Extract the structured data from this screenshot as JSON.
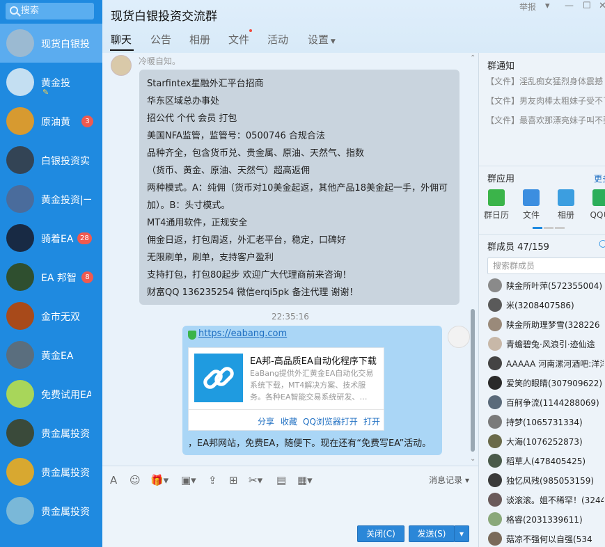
{
  "sidebar": {
    "search_placeholder": "搜索",
    "conversations": [
      {
        "name": "现货白银投",
        "badge": "",
        "color": "#9bbad2"
      },
      {
        "name": "黄金投",
        "badge": "",
        "color": "#c4dff2"
      },
      {
        "name": "原油黄",
        "badge": "3",
        "color": "#d79a30"
      },
      {
        "name": "白银投资实",
        "badge": "",
        "color": "#334455"
      },
      {
        "name": "黄金投资|一",
        "badge": "",
        "color": "#4a6c9c"
      },
      {
        "name": "骑着EA",
        "badge": "28",
        "color": "#182a44"
      },
      {
        "name": "EA 邦智",
        "badge": "8",
        "color": "#2f4f2f"
      },
      {
        "name": "金市无双",
        "badge": "",
        "color": "#a84a1a"
      },
      {
        "name": "黄金EA",
        "badge": "",
        "color": "#5a6e7e"
      },
      {
        "name": "免费试用EA",
        "badge": "",
        "color": "#a8d65a"
      },
      {
        "name": "贵金属投资",
        "badge": "",
        "color": "#3a4a3a"
      },
      {
        "name": "贵金属投资",
        "badge": "",
        "color": "#d8a830"
      },
      {
        "name": "贵金属投资",
        "badge": "",
        "color": "#7ab8d8"
      }
    ]
  },
  "header": {
    "title": "现货白银投资交流群",
    "report": "举报",
    "tabs": [
      "聊天",
      "公告",
      "相册",
      "文件",
      "活动",
      "设置"
    ]
  },
  "chat": {
    "sender": "冷暖自知。",
    "message_lines": [
      "Starfintex星融外汇平台招商",
      "华东区域总办事处",
      "招公代 个代 会员 打包",
      "美国NFA监管，监管号：0500746 合规合法",
      "品种齐全，包含货币兑、贵金属、原油、天然气、指数",
      "（货币、黄金、原油、天然气）超高返佣",
      "两种模式。A：纯佣（货币对10美金起返，其他产品18美金起一手，外佣可",
      "加）。B：头寸模式。",
      "MT4通用软件，正规安全",
      "佣金日返，打包周返，外汇老平台，稳定，口碑好",
      "无限刷单，刷单，支持客户盈利",
      "支持打包，打包80起步      欢迎广大代理商前来咨询！",
      "财富QQ  136235254  微信erqi5pk   备注代理 谢谢！"
    ],
    "timestamp": "22:35:16",
    "link_url": "https://eabang.com",
    "card_title": "EA邦-高品质EA自动化程序下载",
    "card_desc": "EaBang提供外汇黄金EA自动化交易系统下载，MT4解决方案、技术服务。各种EA智能交易系统研发、…",
    "card_actions": [
      "分享",
      "收藏",
      "QQ浏览器打开",
      "打开"
    ],
    "after_text": "，EA邦网站，免费EA，随便下。现在还有“免费写EA”活动。"
  },
  "toolbar": {
    "history": "消息记录",
    "close_btn": "关闭(C)",
    "send_btn": "发送(S)"
  },
  "right": {
    "notice_title": "群通知",
    "notices": [
      "【文件】淫乱痴女猛烈身体震撼（",
      "【文件】男友肉棒太粗妹子受不了",
      "【文件】最喜欢那漂亮妹子叫不要"
    ],
    "apps_title": "群应用",
    "apps_more": "更多",
    "apps": [
      {
        "label": "群日历",
        "color": "#3bb44a"
      },
      {
        "label": "文件",
        "color": "#3c8ee0"
      },
      {
        "label": "相册",
        "color": "#3c9ee0"
      },
      {
        "label": "QQ电",
        "color": "#2cae5a"
      }
    ],
    "members_title": "群成员 47/159",
    "member_search": "搜索群成员",
    "members": [
      "陕金所叶萍(572355004)",
      "米(3208407586)",
      "陕金所助理梦雪(328226",
      "青蟾碧兔·风浪引·迹仙途",
      "AAAAA 河南漯河酒吧:洋洋(",
      "爱笑的眼睛(307909622)",
      "百舸争流(1144288069)",
      "持梦(1065731334)",
      "大海(1076252873)",
      "稻草人(478405425)",
      "独忆风残(985053159)",
      "谈滚滚。姐不稀罕！(32448",
      "格睿(2031339611)",
      "菇凉不强何以自强(534"
    ]
  }
}
